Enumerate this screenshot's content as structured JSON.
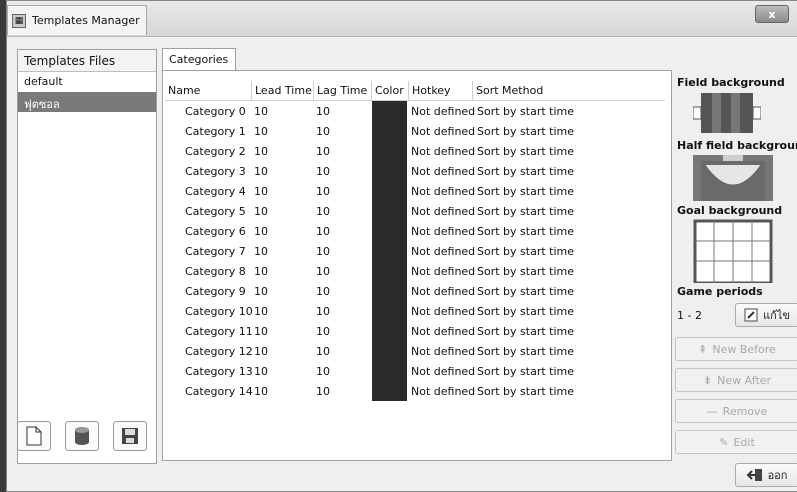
{
  "window": {
    "title": "Templates Manager",
    "close_label": "x"
  },
  "left": {
    "header": "Templates Files",
    "files": [
      {
        "name": "default",
        "selected": false
      },
      {
        "name": "ฟุตซอล",
        "selected": true
      }
    ]
  },
  "tab": {
    "label": "Categories"
  },
  "table": {
    "columns": [
      "Name",
      "Lead Time",
      "Lag Time",
      "Color",
      "Hotkey",
      "Sort Method"
    ],
    "rows": [
      [
        "Category 0",
        "10",
        "10",
        "",
        "Not defined",
        "Sort by start time"
      ],
      [
        "Category 1",
        "10",
        "10",
        "",
        "Not defined",
        "Sort by start time"
      ],
      [
        "Category 2",
        "10",
        "10",
        "",
        "Not defined",
        "Sort by start time"
      ],
      [
        "Category 3",
        "10",
        "10",
        "",
        "Not defined",
        "Sort by start time"
      ],
      [
        "Category 4",
        "10",
        "10",
        "",
        "Not defined",
        "Sort by start time"
      ],
      [
        "Category 5",
        "10",
        "10",
        "",
        "Not defined",
        "Sort by start time"
      ],
      [
        "Category 6",
        "10",
        "10",
        "",
        "Not defined",
        "Sort by start time"
      ],
      [
        "Category 7",
        "10",
        "10",
        "",
        "Not defined",
        "Sort by start time"
      ],
      [
        "Category 8",
        "10",
        "10",
        "",
        "Not defined",
        "Sort by start time"
      ],
      [
        "Category 9",
        "10",
        "10",
        "",
        "Not defined",
        "Sort by start time"
      ],
      [
        "Category 10",
        "10",
        "10",
        "",
        "Not defined",
        "Sort by start time"
      ],
      [
        "Category 11",
        "10",
        "10",
        "",
        "Not defined",
        "Sort by start time"
      ],
      [
        "Category 12",
        "10",
        "10",
        "",
        "Not defined",
        "Sort by start time"
      ],
      [
        "Category 13",
        "10",
        "10",
        "",
        "Not defined",
        "Sort by start time"
      ],
      [
        "Category 14",
        "10",
        "10",
        "",
        "Not defined",
        "Sort by start time"
      ]
    ],
    "category_color": "#2b2b2b"
  },
  "right": {
    "field_bg_label": "Field background",
    "half_field_bg_label": "Half field background",
    "goal_bg_label": "Goal background",
    "game_periods_label": "Game periods",
    "game_periods_value": "1 - 2",
    "edit_periods_label": "แก้ไข",
    "new_before_label": "New Before",
    "new_after_label": "New After",
    "remove_label": "Remove",
    "edit_label": "Edit",
    "exit_label": "ออก"
  }
}
